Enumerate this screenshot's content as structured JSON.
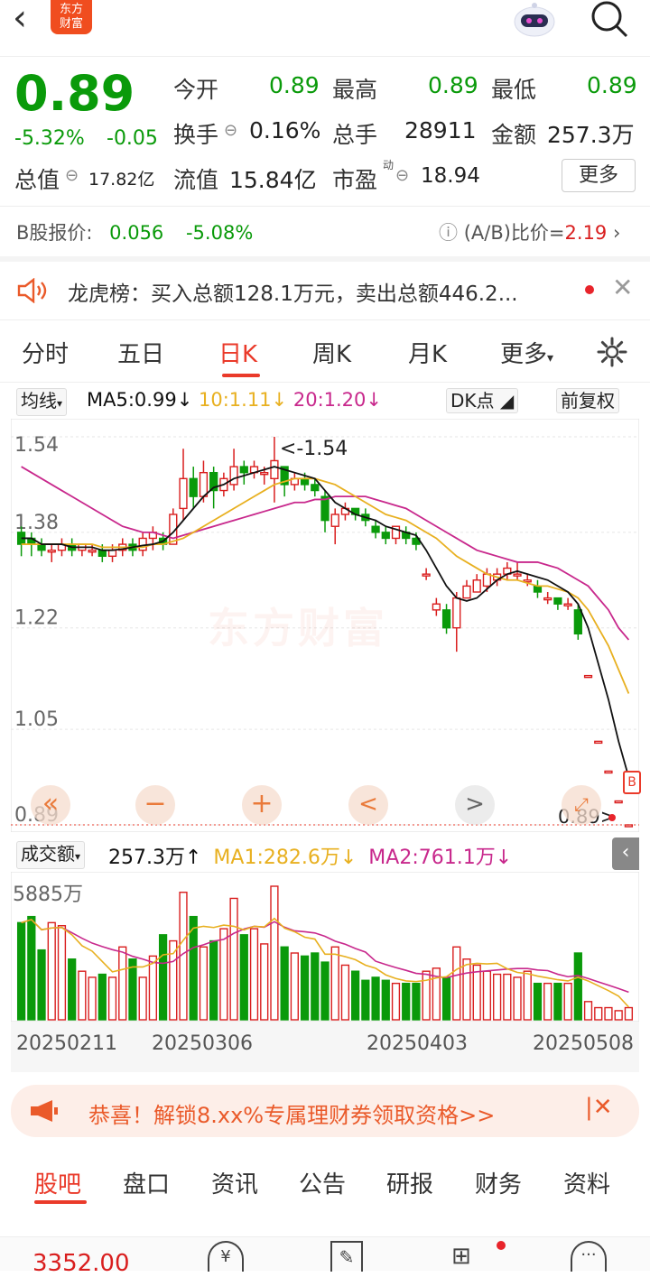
{
  "header": {
    "logo_line1": "东方",
    "logo_line2": "财富",
    "back_icon": "chevron-left-icon",
    "robot_icon": "robot-assistant-icon",
    "search_icon": "search-icon"
  },
  "quote": {
    "price": "0.89",
    "change_pct": "-5.32%",
    "change_abs": "-0.05",
    "open_label": "今开",
    "open": "0.89",
    "high_label": "最高",
    "high": "0.89",
    "low_label": "最低",
    "low": "0.89",
    "turnover_label": "换手",
    "turnover": "0.16%",
    "volume_label": "总手",
    "volume": "28911",
    "amount_label": "金额",
    "amount": "257.3万",
    "mktcap_label": "总值",
    "mktcap": "17.82亿",
    "float_label": "流值",
    "float": "15.84亿",
    "pe_label": "市盈",
    "pe_sup": "动",
    "pe": "18.94",
    "more_label": "更多",
    "b_label": "B股报价:",
    "b_price": "0.056",
    "b_pct": "-5.08%",
    "ratio_label": "(A/B)比价=",
    "ratio": "2.19"
  },
  "notice": {
    "text": "龙虎榜：买入总额128.1万元，卖出总额446.2..."
  },
  "tabs": [
    "分时",
    "五日",
    "日K",
    "周K",
    "月K",
    "更多"
  ],
  "active_tab": "日K",
  "ma_bar": {
    "avg_label": "均线",
    "ma5": "MA5:0.99",
    "ma10": "10:1.11",
    "ma20": "20:1.20",
    "dk_label": "DK点",
    "adjust_label": "前复权"
  },
  "vol_bar": {
    "label": "成交额",
    "value": "257.3万",
    "ma1": "MA1:282.6万",
    "ma2": "MA2:761.1万"
  },
  "chart_data": {
    "type": "candlestick",
    "y_ticks": [
      "1.54",
      "1.38",
      "1.22",
      "1.05",
      "0.89"
    ],
    "ylim": [
      0.89,
      1.54
    ],
    "max_annotation": "<-1.54",
    "last_annotation": "0.89>",
    "vol_max_label": "5885万",
    "x_labels": [
      "20250211",
      "20250306",
      "20250403",
      "20250508"
    ],
    "colors": {
      "up": "#d91e1e",
      "down": "#0a9a0a",
      "ma5": "#111111",
      "ma10": "#e8b020",
      "ma20": "#c8288c"
    },
    "candles": [
      [
        1.38,
        1.36,
        1.39,
        1.34
      ],
      [
        1.37,
        1.36,
        1.38,
        1.34
      ],
      [
        1.36,
        1.35,
        1.37,
        1.34
      ],
      [
        1.35,
        1.35,
        1.36,
        1.33
      ],
      [
        1.35,
        1.36,
        1.37,
        1.34
      ],
      [
        1.36,
        1.35,
        1.37,
        1.34
      ],
      [
        1.35,
        1.36,
        1.36,
        1.34
      ],
      [
        1.35,
        1.35,
        1.36,
        1.34
      ],
      [
        1.35,
        1.34,
        1.36,
        1.33
      ],
      [
        1.34,
        1.35,
        1.36,
        1.33
      ],
      [
        1.35,
        1.36,
        1.37,
        1.34
      ],
      [
        1.36,
        1.35,
        1.37,
        1.34
      ],
      [
        1.35,
        1.37,
        1.38,
        1.34
      ],
      [
        1.37,
        1.38,
        1.39,
        1.35
      ],
      [
        1.37,
        1.36,
        1.38,
        1.35
      ],
      [
        1.36,
        1.41,
        1.42,
        1.36
      ],
      [
        1.42,
        1.47,
        1.52,
        1.4
      ],
      [
        1.47,
        1.44,
        1.49,
        1.42
      ],
      [
        1.44,
        1.48,
        1.5,
        1.43
      ],
      [
        1.48,
        1.45,
        1.49,
        1.42
      ],
      [
        1.45,
        1.47,
        1.48,
        1.44
      ],
      [
        1.46,
        1.49,
        1.52,
        1.45
      ],
      [
        1.49,
        1.48,
        1.5,
        1.46
      ],
      [
        1.48,
        1.49,
        1.5,
        1.47
      ],
      [
        1.48,
        1.48,
        1.49,
        1.46
      ],
      [
        1.47,
        1.5,
        1.54,
        1.43
      ],
      [
        1.49,
        1.46,
        1.49,
        1.44
      ],
      [
        1.46,
        1.47,
        1.48,
        1.45
      ],
      [
        1.47,
        1.46,
        1.48,
        1.45
      ],
      [
        1.46,
        1.45,
        1.47,
        1.44
      ],
      [
        1.44,
        1.4,
        1.45,
        1.38
      ],
      [
        1.39,
        1.41,
        1.42,
        1.36
      ],
      [
        1.41,
        1.42,
        1.43,
        1.4
      ],
      [
        1.42,
        1.41,
        1.42,
        1.4
      ],
      [
        1.41,
        1.4,
        1.42,
        1.39
      ],
      [
        1.39,
        1.38,
        1.4,
        1.37
      ],
      [
        1.38,
        1.37,
        1.39,
        1.36
      ],
      [
        1.37,
        1.39,
        1.39,
        1.36
      ],
      [
        1.38,
        1.37,
        1.39,
        1.36
      ],
      [
        1.37,
        1.36,
        1.38,
        1.35
      ],
      [
        1.31,
        1.31,
        1.32,
        1.3
      ],
      [
        1.25,
        1.26,
        1.27,
        1.24
      ],
      [
        1.25,
        1.22,
        1.26,
        1.21
      ],
      [
        1.22,
        1.27,
        1.28,
        1.18
      ],
      [
        1.27,
        1.29,
        1.3,
        1.27
      ],
      [
        1.28,
        1.3,
        1.31,
        1.28
      ],
      [
        1.29,
        1.31,
        1.32,
        1.28
      ],
      [
        1.3,
        1.31,
        1.32,
        1.29
      ],
      [
        1.31,
        1.32,
        1.33,
        1.3
      ],
      [
        1.31,
        1.31,
        1.33,
        1.3
      ],
      [
        1.3,
        1.3,
        1.31,
        1.29
      ],
      [
        1.29,
        1.28,
        1.3,
        1.27
      ],
      [
        1.27,
        1.27,
        1.28,
        1.26
      ],
      [
        1.27,
        1.26,
        1.27,
        1.25
      ],
      [
        1.26,
        1.26,
        1.27,
        1.25
      ],
      [
        1.25,
        1.21,
        1.26,
        1.2
      ],
      [
        1.14,
        1.14,
        1.14,
        1.14
      ],
      [
        1.03,
        1.03,
        1.03,
        1.03
      ],
      [
        0.98,
        0.98,
        0.98,
        0.98
      ],
      [
        0.93,
        0.93,
        0.93,
        0.93
      ],
      [
        0.89,
        0.89,
        0.89,
        0.89
      ]
    ],
    "ma5": [
      1.37,
      1.37,
      1.36,
      1.36,
      1.36,
      1.355,
      1.355,
      1.355,
      1.35,
      1.35,
      1.352,
      1.355,
      1.358,
      1.36,
      1.365,
      1.38,
      1.4,
      1.42,
      1.44,
      1.455,
      1.46,
      1.47,
      1.475,
      1.48,
      1.485,
      1.49,
      1.485,
      1.48,
      1.475,
      1.47,
      1.45,
      1.43,
      1.42,
      1.41,
      1.405,
      1.4,
      1.39,
      1.385,
      1.38,
      1.375,
      1.35,
      1.32,
      1.29,
      1.27,
      1.265,
      1.27,
      1.285,
      1.3,
      1.31,
      1.315,
      1.31,
      1.305,
      1.3,
      1.29,
      1.28,
      1.26,
      1.22,
      1.16,
      1.1,
      1.03,
      0.97
    ],
    "ma10": [
      1.36,
      1.36,
      1.36,
      1.36,
      1.36,
      1.36,
      1.36,
      1.36,
      1.355,
      1.355,
      1.355,
      1.355,
      1.355,
      1.36,
      1.36,
      1.365,
      1.37,
      1.38,
      1.39,
      1.4,
      1.41,
      1.42,
      1.43,
      1.44,
      1.45,
      1.46,
      1.465,
      1.47,
      1.47,
      1.47,
      1.465,
      1.46,
      1.45,
      1.44,
      1.43,
      1.42,
      1.41,
      1.405,
      1.4,
      1.39,
      1.38,
      1.37,
      1.355,
      1.34,
      1.33,
      1.32,
      1.31,
      1.305,
      1.3,
      1.3,
      1.295,
      1.29,
      1.29,
      1.285,
      1.28,
      1.27,
      1.25,
      1.22,
      1.19,
      1.15,
      1.11
    ],
    "ma20": [
      1.49,
      1.48,
      1.47,
      1.46,
      1.45,
      1.44,
      1.43,
      1.42,
      1.41,
      1.4,
      1.39,
      1.385,
      1.38,
      1.38,
      1.375,
      1.37,
      1.375,
      1.38,
      1.385,
      1.39,
      1.395,
      1.4,
      1.405,
      1.41,
      1.415,
      1.42,
      1.425,
      1.43,
      1.43,
      1.435,
      1.435,
      1.44,
      1.44,
      1.44,
      1.44,
      1.435,
      1.43,
      1.425,
      1.42,
      1.41,
      1.4,
      1.39,
      1.38,
      1.37,
      1.36,
      1.35,
      1.345,
      1.34,
      1.335,
      1.33,
      1.33,
      1.33,
      1.325,
      1.32,
      1.31,
      1.3,
      1.29,
      1.27,
      1.25,
      1.22,
      1.2
    ],
    "volumes": [
      1600,
      1700,
      1150,
      1600,
      1550,
      1000,
      800,
      700,
      750,
      700,
      1200,
      1000,
      700,
      1050,
      1400,
      1300,
      2100,
      1700,
      1200,
      1300,
      1500,
      2000,
      1400,
      1500,
      1250,
      2200,
      1200,
      1100,
      1050,
      1100,
      950,
      1200,
      900,
      800,
      650,
      700,
      650,
      600,
      600,
      600,
      800,
      850,
      700,
      1200,
      1000,
      900,
      800,
      750,
      750,
      700,
      800,
      600,
      600,
      600,
      600,
      1100,
      300,
      200,
      200,
      150,
      200
    ],
    "vol_max": 2200
  },
  "nav_labels": {
    "zoom_out": "−",
    "zoom_in": "+",
    "prev": "<",
    "next": ">",
    "rewind": "«"
  },
  "promo": {
    "text": "恭喜！解锁8.xx%专属理财券领取资格>>"
  },
  "bottom_tabs": [
    "股吧",
    "盘口",
    "资讯",
    "公告",
    "研报",
    "财务",
    "资料"
  ],
  "bottom_bar": {
    "index_value": "3352.00"
  }
}
